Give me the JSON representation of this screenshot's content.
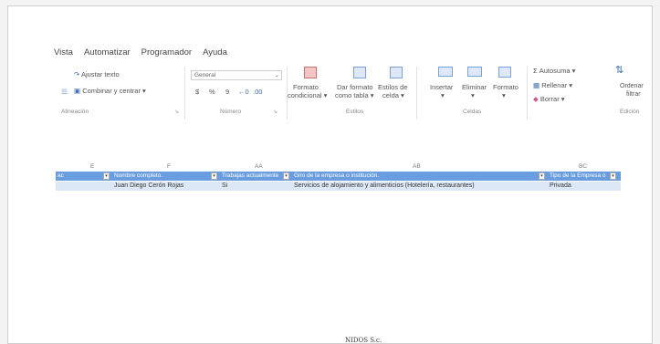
{
  "menu": [
    "Vista",
    "Automatizar",
    "Programador",
    "Ayuda"
  ],
  "ribbon": {
    "wrap_text": "Ajustar texto",
    "merge_center": "Combinar y centrar",
    "number_format": "General",
    "currency": "$",
    "percent": "%",
    "comma": "9",
    "cond_format": [
      "Formato",
      "condicional"
    ],
    "table_format": [
      "Dar formato",
      "como tabla"
    ],
    "cell_styles": [
      "Estilos de",
      "celda"
    ],
    "insert": "Insertar",
    "delete": "Eliminar",
    "format": "Formato",
    "autosum": "Autosuma",
    "fill": "Rellenar",
    "clear": "Borrar",
    "sort": [
      "Ordenar",
      "filtrar"
    ],
    "groups": [
      "Alineación",
      "Número",
      "Estilos",
      "Celdas",
      "Edición"
    ]
  },
  "grid": {
    "col_letters": [
      "E",
      "F",
      "AA",
      "AB",
      "BC"
    ],
    "headers": [
      "Nombre completo.",
      "Trabajas actualmente",
      "Giro de la empresa o institución.",
      "Tipo de la Empresa o"
    ],
    "row": [
      "Juan Diego Cerón Rojas",
      "Si",
      "Servicios de alojamiento y alimenticios (Hotelería, restaurantes)",
      "Privada"
    ]
  },
  "footer": "NIDOS S.c."
}
